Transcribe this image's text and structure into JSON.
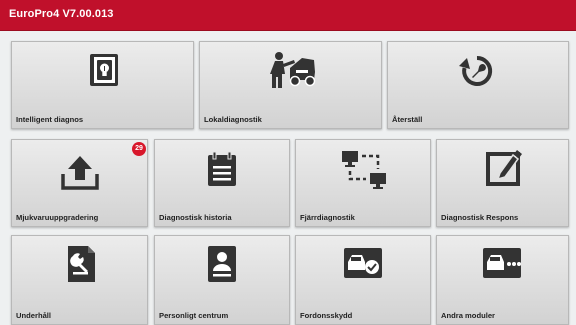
{
  "app": {
    "title": "EuroPro4 V7.00.013"
  },
  "colors": {
    "header": "#c0102b",
    "badge": "#d8172b",
    "icon": "#333333"
  },
  "tiles": [
    {
      "label": "Intelligent diagnos",
      "icon": "smart-diagnose-icon"
    },
    {
      "label": "Lokaldiagnostik",
      "icon": "local-diagnose-icon"
    },
    {
      "label": "Återställ",
      "icon": "reset-icon"
    },
    {
      "label": "Mjukvaruuppgradering",
      "icon": "upload-icon",
      "badge": "29"
    },
    {
      "label": "Diagnostisk historia",
      "icon": "clipboard-icon"
    },
    {
      "label": "Fjärrdiagnostik",
      "icon": "remote-diagnose-icon"
    },
    {
      "label": "Diagnostisk Respons",
      "icon": "feedback-edit-icon"
    },
    {
      "label": "Underhåll",
      "icon": "maintenance-doc-icon"
    },
    {
      "label": "Personligt centrum",
      "icon": "personal-center-icon"
    },
    {
      "label": "Fordonsskydd",
      "icon": "vehicle-protect-icon"
    },
    {
      "label": "Andra moduler",
      "icon": "other-modules-icon"
    }
  ]
}
